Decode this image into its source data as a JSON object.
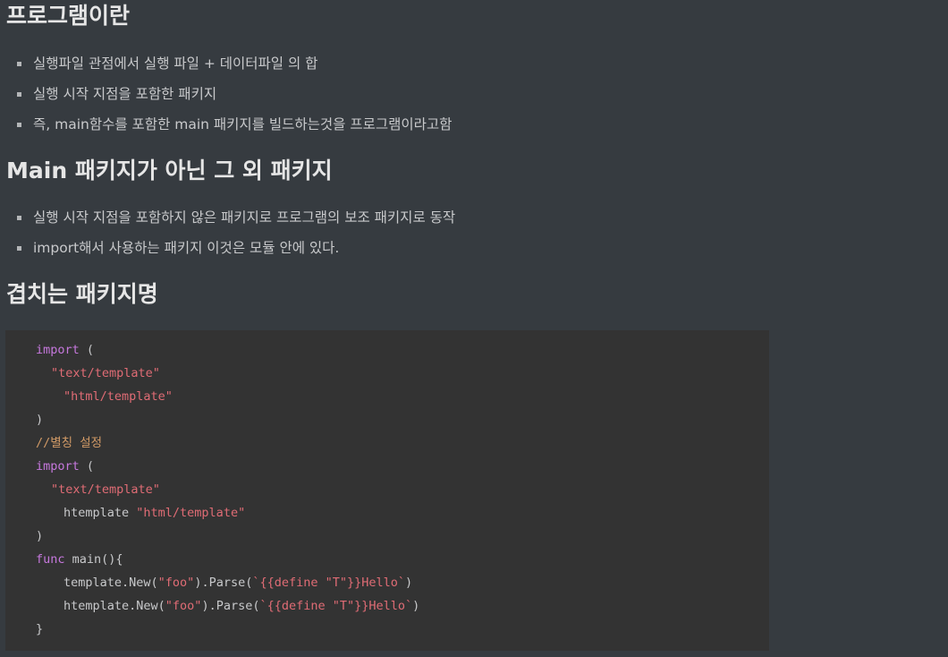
{
  "sections": [
    {
      "heading": "프로그램이란",
      "items": [
        "실행파일 관점에서 실행 파일 + 데이터파일 의 합",
        "실행 시작 지점을 포함한 패키지",
        "즉, main함수를 포함한 main 패키지를 빌드하는것을 프로그램이라고함"
      ]
    },
    {
      "heading": "Main 패키지가 아닌 그 외 패키지",
      "items": [
        "실행 시작 지점을 포함하지 않은 패키지로 프로그램의 보조 패키지로 동작",
        "import해서 사용하는 패키지 이것은 모듈 안에 있다."
      ]
    },
    {
      "heading": "겹치는 패키지명"
    }
  ],
  "code": {
    "lines": [
      {
        "kw": "import",
        "text": " ("
      },
      {
        "str": "\"text/template\""
      },
      {
        "str": "\"html/template\""
      },
      {
        "text": ")"
      },
      {
        "comment": "//별칭 설정"
      },
      {
        "kw": "import",
        "text": " ("
      },
      {
        "str": "\"text/template\""
      },
      {
        "text": "htemplate ",
        "str": "\"html/template\""
      },
      {
        "text": ")"
      },
      {
        "kw": "func",
        "text": " main(){"
      },
      {
        "text": "template.New(",
        "str": "\"foo\"",
        "text2": ").Parse(",
        "str2": "`{{define \"T\"}}Hello`",
        "text3": ")"
      },
      {
        "text": "htemplate.New(",
        "str": "\"foo\"",
        "text2": ").Parse(",
        "str2": "`{{define \"T\"}}Hello`",
        "text3": ")"
      },
      {
        "text": "}"
      }
    ]
  }
}
